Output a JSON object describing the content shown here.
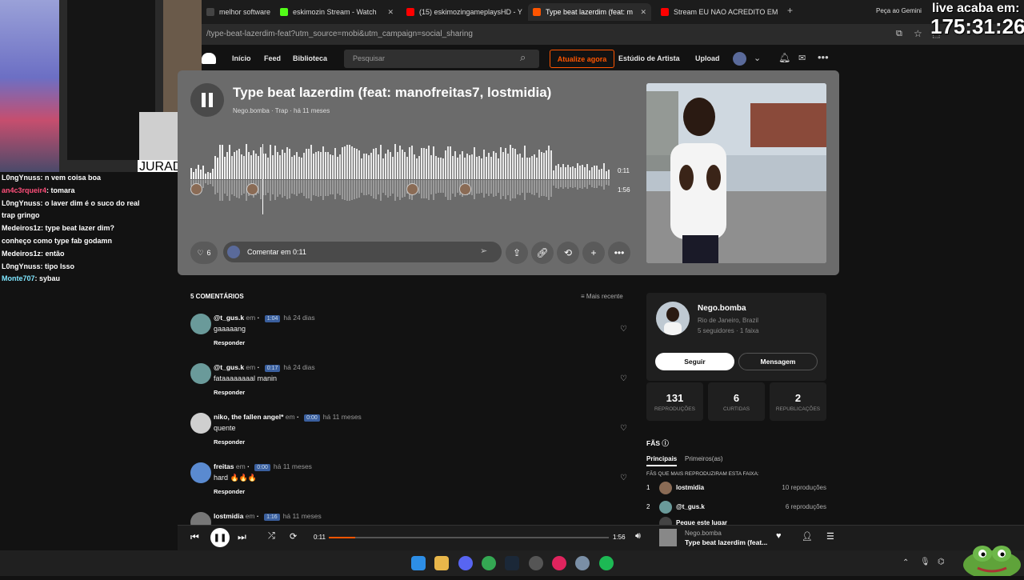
{
  "browser": {
    "tabs": [
      {
        "label": "melhor software p",
        "color": "#444444"
      },
      {
        "label": "eskimozin Stream - Watch",
        "color": "#53fc18"
      },
      {
        "label": "(15) eskimozingameplaysHD - Y",
        "color": "#ff0000"
      },
      {
        "label": "Type beat lazerdim (feat: m",
        "color": "#ff5500",
        "active": true
      },
      {
        "label": "Stream EU NAO ACREDITO EM",
        "color": "#ff0000"
      }
    ],
    "url": "/type-beat-lazerdim-feat?utm_source=mobi&utm_campaign=social_sharing",
    "gemini_label": "Peça ao Gemini"
  },
  "site": {
    "nav": [
      "Início",
      "Feed",
      "Biblioteca"
    ],
    "search_placeholder": "Pesquisar",
    "upgrade_label": "Atualize agora",
    "artist_studio": "Estúdio de Artista",
    "upload": "Upload"
  },
  "track": {
    "title": "Type beat lazerdim (feat: manofreitas7, lostmidia)",
    "artist": "Nego.bomba",
    "genre": "Trap",
    "age": "há 11 meses",
    "current_time": "0:11",
    "duration": "1:56",
    "likes": "6",
    "comment_placeholder": "Comentar em 0:11",
    "progress": 0.095
  },
  "comments": {
    "count_label": "5 COMENTÁRIOS",
    "sort_label": "Mais recente",
    "em": "em",
    "reply": "Responder",
    "items": [
      {
        "user": "@t_gus.k",
        "ts": "1:04",
        "ago": "há 24 dias",
        "text": "gaaaaang"
      },
      {
        "user": "@t_gus.k",
        "ts": "0:17",
        "ago": "há 24 dias",
        "text": "fataaaaaaaal manin"
      },
      {
        "user": "niko, the fallen angel*",
        "ts": "0:00",
        "ago": "há 11 meses",
        "text": "quente"
      },
      {
        "user": "freitas",
        "ts": "0:00",
        "ago": "há 11 meses",
        "text": "hard 🔥🔥🔥"
      },
      {
        "user": "lostmidia",
        "ts": "1:16",
        "ago": "há 11 meses",
        "text": ""
      }
    ]
  },
  "artist": {
    "name": "Nego.bomba",
    "location": "Rio de Janeiro, Brazil",
    "stats_line": "5 seguidores · 1 faixa",
    "follow": "Seguir",
    "message": "Mensagem"
  },
  "stats": [
    {
      "value": "131",
      "label": "REPRODUÇÕES"
    },
    {
      "value": "6",
      "label": "CURTIDAS"
    },
    {
      "value": "2",
      "label": "REPUBLICAÇÕES"
    }
  ],
  "fans": {
    "heading": "FÃS",
    "tab_main": "Principais",
    "tab_first": "Primeiros(as)",
    "subtitle": "FÃS QUE MAIS REPRODUZIRAM ESTA FAIXA:",
    "items": [
      {
        "rank": "1",
        "name": "lostmidia",
        "count": "10 reproduções"
      },
      {
        "rank": "2",
        "name": "@t_gus.k",
        "count": "6 reproduções"
      },
      {
        "rank": "",
        "name": "Pegue este lugar",
        "count": ""
      }
    ]
  },
  "player": {
    "current_time": "0:11",
    "duration": "1:56",
    "artist": "Nego.bomba",
    "title": "Type beat lazerdim (feat..."
  },
  "overlay": {
    "jurado": "JURADO",
    "timer_label": "live acaba em:",
    "timer": "175:31:26",
    "chat": [
      {
        "user": "L0ngYnuss",
        "msg": "n vem coisa boa",
        "color": "#ffffff"
      },
      {
        "user": "an4c3rqueir4",
        "msg": "tomara",
        "color": "#ff4f7a"
      },
      {
        "user": "L0ngYnuss",
        "msg": "o laver dim é o suco do real",
        "color": "#ffffff"
      },
      {
        "user": "",
        "msg": "trap gringo",
        "color": "#ffffff"
      },
      {
        "user": "Medeiros1z",
        "msg": "type beat lazer dim?",
        "color": "#ffffff"
      },
      {
        "user": "",
        "msg": "conheço como type fab godamn",
        "color": "#ffffff"
      },
      {
        "user": "Medeiros1z",
        "msg": "então",
        "color": "#ffffff"
      },
      {
        "user": "L0ngYnuss",
        "msg": "tipo Isso",
        "color": "#ffffff"
      },
      {
        "user": "Monte707",
        "msg": "sybau",
        "color": "#7fe6ff"
      }
    ]
  }
}
